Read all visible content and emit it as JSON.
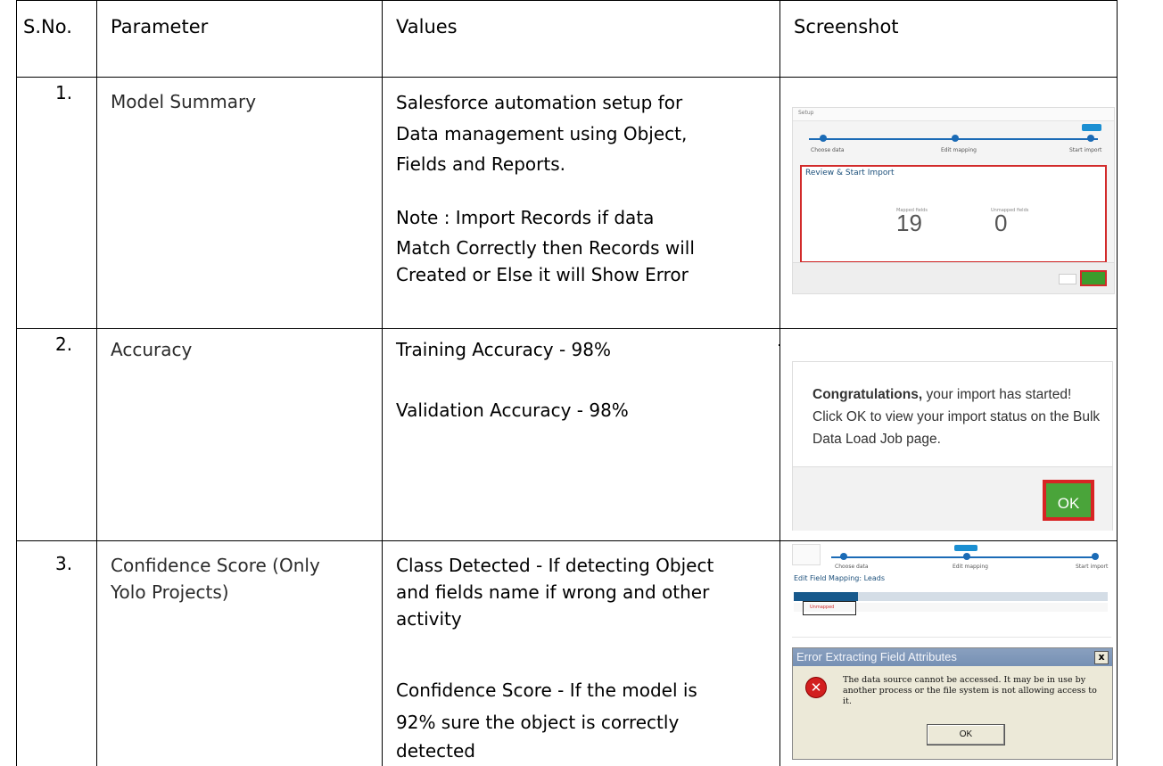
{
  "table": {
    "headers": [
      "S.No.",
      "Parameter",
      "Values",
      "Screenshot"
    ],
    "rows": [
      {
        "sno": "1.",
        "parameter": "Model Summary",
        "values": [
          "Salesforce automation setup for",
          "Data management using Object,",
          "Fields and Reports.",
          "Note : Import Records if data",
          "Match Correctly then Records will",
          "Created or Else it will Show Error"
        ]
      },
      {
        "sno": "2.",
        "parameter": "Accuracy",
        "values": [
          "Training Accuracy - 98%",
          "Validation Accuracy - 98%"
        ]
      },
      {
        "sno": "3.",
        "parameter": [
          "Confidence Score (Only",
          "Yolo Projects)"
        ],
        "values": [
          "Class Detected - If detecting Object",
          "and fields name if wrong and other",
          "activity",
          "Confidence Score - If the model is",
          "92% sure the object is correctly",
          "detected"
        ]
      }
    ]
  },
  "screenshots": {
    "shot1": {
      "nav": "Setup",
      "steps": [
        "Choose data",
        "Edit mapping",
        "Start import"
      ],
      "title": "Review & Start Import",
      "col_mapped": "Mapped fields",
      "col_unmapped": "Unmapped fields",
      "mapped_count": "19",
      "unmapped_count": "0"
    },
    "shot2": {
      "bold": "Congratulations,",
      "message_rest": " your import has started!",
      "message_line2": "Click OK to view your import status on the Bulk",
      "message_line3": "Data Load Job page.",
      "ok_label": "OK"
    },
    "shot3a": {
      "steps": [
        "Choose data",
        "Edit mapping",
        "Start import"
      ],
      "title": "Edit Field Mapping: Leads",
      "unmapped": "Unmapped"
    },
    "shot3b": {
      "title": "Error Extracting Field Attributes",
      "message": "The data source cannot be accessed. It may be in use by another process or the file system is not allowing access to it.",
      "ok_label": "OK",
      "close_label": "x"
    }
  }
}
